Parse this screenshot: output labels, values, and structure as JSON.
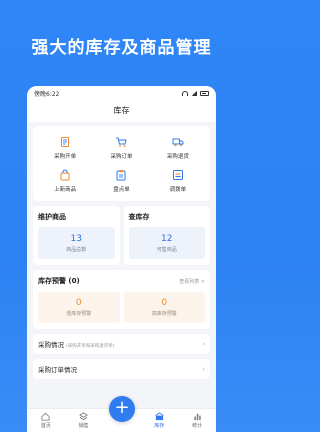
{
  "promo": {
    "title": "强大的库存及商品管理"
  },
  "status_bar": {
    "time": "傍晚6:22"
  },
  "header": {
    "title": "库存"
  },
  "quick_actions": [
    {
      "label": "采购开单",
      "icon": "purchase-order-icon"
    },
    {
      "label": "采购订单",
      "icon": "cart-icon"
    },
    {
      "label": "采购退货",
      "icon": "truck-icon"
    },
    {
      "label": "上新商品",
      "icon": "shopping-bag-icon"
    },
    {
      "label": "盘点单",
      "icon": "clipboard-icon"
    },
    {
      "label": "调拨单",
      "icon": "transfer-icon"
    }
  ],
  "maintain_goods": {
    "title": "维护商品",
    "value": "13",
    "caption": "商品总数"
  },
  "check_stock": {
    "title": "查库存",
    "value": "12",
    "caption": "可售商品"
  },
  "stock_warning": {
    "title": "库存预警 (0)",
    "more": "查看列表 >",
    "low": {
      "value": "0",
      "caption": "低库存预警"
    },
    "high": {
      "value": "0",
      "caption": "高库存预警"
    }
  },
  "purchase_status": {
    "title": "采购情况",
    "subtitle": "(采购开单和采购退货单)"
  },
  "purchase_orders": {
    "title": "采购订单情况"
  },
  "tabbar": {
    "tabs": [
      {
        "label": "首页",
        "icon": "home-icon"
      },
      {
        "label": "销售",
        "icon": "layers-icon"
      },
      {
        "label": "库存",
        "icon": "warehouse-icon",
        "active": true
      },
      {
        "label": "统计",
        "icon": "chart-icon"
      }
    ],
    "fab_label": "+"
  },
  "colors": {
    "accent": "#2f7cf0",
    "warning": "#f08a2c",
    "background": "#2f86f6"
  }
}
